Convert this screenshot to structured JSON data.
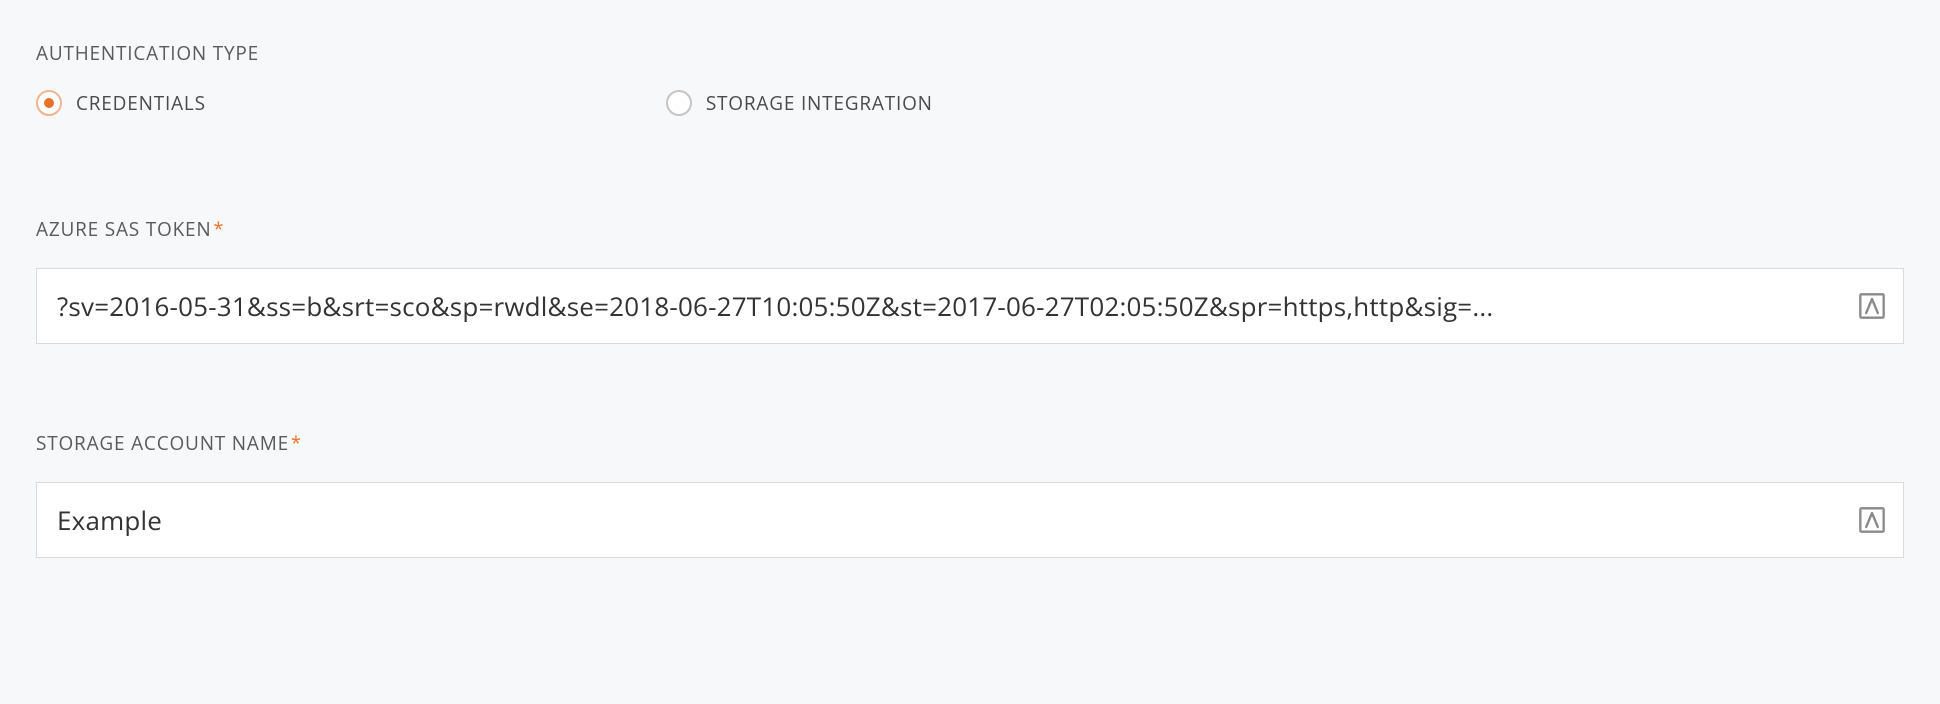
{
  "auth": {
    "section_label": "AUTHENTICATION TYPE",
    "options": {
      "credentials_label": "CREDENTIALS",
      "storage_integration_label": "STORAGE INTEGRATION"
    },
    "selected": "credentials"
  },
  "sas_token": {
    "label": "AZURE SAS TOKEN",
    "required_marker": "*",
    "value": "?sv=2016-05-31&ss=b&srt=sco&sp=rwdl&se=2018-06-27T10:05:50Z&st=2017-06-27T02:05:50Z&spr=https,http&sig=..."
  },
  "storage_account": {
    "label": "STORAGE ACCOUNT NAME",
    "required_marker": "*",
    "value": "Example"
  }
}
